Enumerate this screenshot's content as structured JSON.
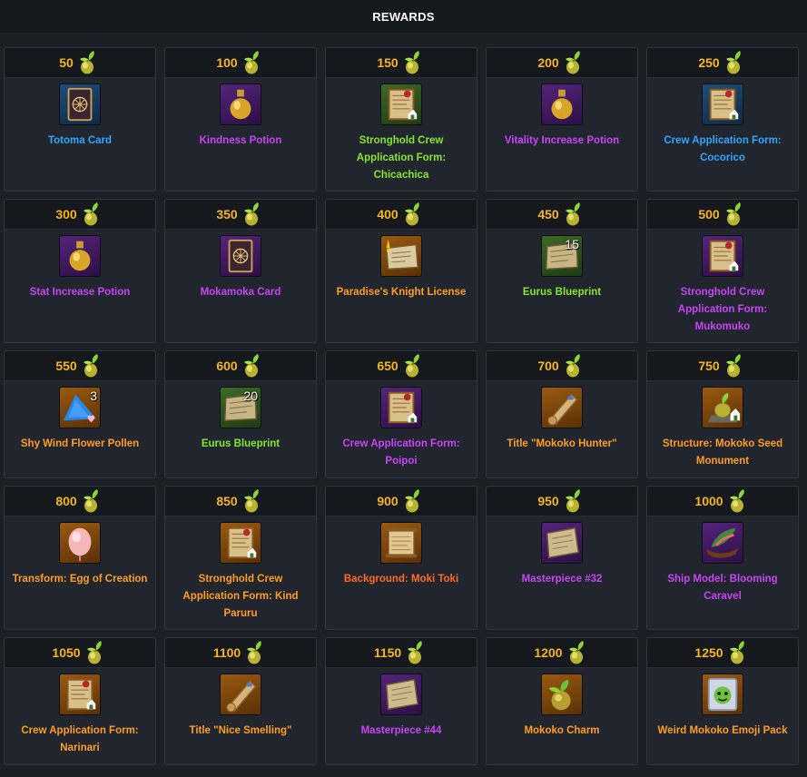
{
  "header": {
    "title": "REWARDS"
  },
  "colors": {
    "blue": "#2ea6ff",
    "purple": "#c843f5",
    "green": "#86e62a",
    "orange": "#ff9c22",
    "red": "#ff6a21",
    "points": "#f5b622"
  },
  "rewards": [
    {
      "points": "50",
      "name": "Totoma Card",
      "color": "#2ea6ff",
      "bg": "blue",
      "icon": "card-icon"
    },
    {
      "points": "100",
      "name": "Kindness Potion",
      "color": "#c843f5",
      "bg": "purple",
      "icon": "potion-icon"
    },
    {
      "points": "150",
      "name": "Stronghold Crew Application Form: Chicachica",
      "color": "#86e62a",
      "bg": "green",
      "icon": "application-form-icon"
    },
    {
      "points": "200",
      "name": "Vitality Increase Potion",
      "color": "#c843f5",
      "bg": "purple",
      "icon": "potion-icon"
    },
    {
      "points": "250",
      "name": "Crew Application Form: Cocorico",
      "color": "#2ea6ff",
      "bg": "blue",
      "icon": "application-form-icon"
    },
    {
      "points": "300",
      "name": "Stat Increase Potion",
      "color": "#c843f5",
      "bg": "purple",
      "icon": "potion-icon"
    },
    {
      "points": "350",
      "name": "Mokamoka Card",
      "color": "#c843f5",
      "bg": "purple",
      "icon": "card-icon"
    },
    {
      "points": "400",
      "name": "Paradise's Knight License",
      "color": "#ff9c22",
      "bg": "orange",
      "icon": "license-icon"
    },
    {
      "points": "450",
      "name": "Eurus Blueprint",
      "color": "#86e62a",
      "bg": "green",
      "icon": "blueprint-icon",
      "count": "15"
    },
    {
      "points": "500",
      "name": "Stronghold Crew Application Form: Mukomuko",
      "color": "#c843f5",
      "bg": "purple",
      "icon": "application-form-icon"
    },
    {
      "points": "550",
      "name": "Shy Wind Flower Pollen",
      "color": "#ff9c22",
      "bg": "orange",
      "icon": "pollen-icon",
      "count": "3"
    },
    {
      "points": "600",
      "name": "Eurus Blueprint",
      "color": "#86e62a",
      "bg": "green",
      "icon": "blueprint-icon",
      "count": "20"
    },
    {
      "points": "650",
      "name": "Crew Application Form: Poipoi",
      "color": "#c843f5",
      "bg": "purple",
      "icon": "application-form-icon"
    },
    {
      "points": "700",
      "name": "Title \"Mokoko Hunter\"",
      "color": "#ff9c22",
      "bg": "orange",
      "icon": "scroll-icon"
    },
    {
      "points": "750",
      "name": "Structure: Mokoko Seed Monument",
      "color": "#ff9c22",
      "bg": "orange",
      "icon": "monument-icon"
    },
    {
      "points": "800",
      "name": "Transform: Egg of Creation",
      "color": "#ff9c22",
      "bg": "orange",
      "icon": "egg-icon"
    },
    {
      "points": "850",
      "name": "Stronghold Crew Application Form: Kind Paruru",
      "color": "#ff9c22",
      "bg": "orange",
      "icon": "application-form-icon"
    },
    {
      "points": "900",
      "name": "Background: Moki Toki",
      "color": "#ff6a21",
      "bg": "orange",
      "icon": "background-scroll-icon"
    },
    {
      "points": "950",
      "name": "Masterpiece #32",
      "color": "#c843f5",
      "bg": "purple",
      "icon": "masterpiece-icon"
    },
    {
      "points": "1000",
      "name": "Ship Model: Blooming Caravel",
      "color": "#c843f5",
      "bg": "purple",
      "icon": "ship-icon"
    },
    {
      "points": "1050",
      "name": "Crew Application Form: Narinari",
      "color": "#ff9c22",
      "bg": "orange",
      "icon": "application-form-icon"
    },
    {
      "points": "1100",
      "name": "Title \"Nice Smelling\"",
      "color": "#ff9c22",
      "bg": "orange",
      "icon": "scroll-icon"
    },
    {
      "points": "1150",
      "name": "Masterpiece #44",
      "color": "#c843f5",
      "bg": "purple",
      "icon": "masterpiece-icon"
    },
    {
      "points": "1200",
      "name": "Mokoko Charm",
      "color": "#ff9c22",
      "bg": "orange",
      "icon": "mokoko-charm-icon"
    },
    {
      "points": "1250",
      "name": "Weird Mokoko Emoji Pack",
      "color": "#ff9c22",
      "bg": "orange",
      "icon": "emoji-pack-icon"
    }
  ]
}
